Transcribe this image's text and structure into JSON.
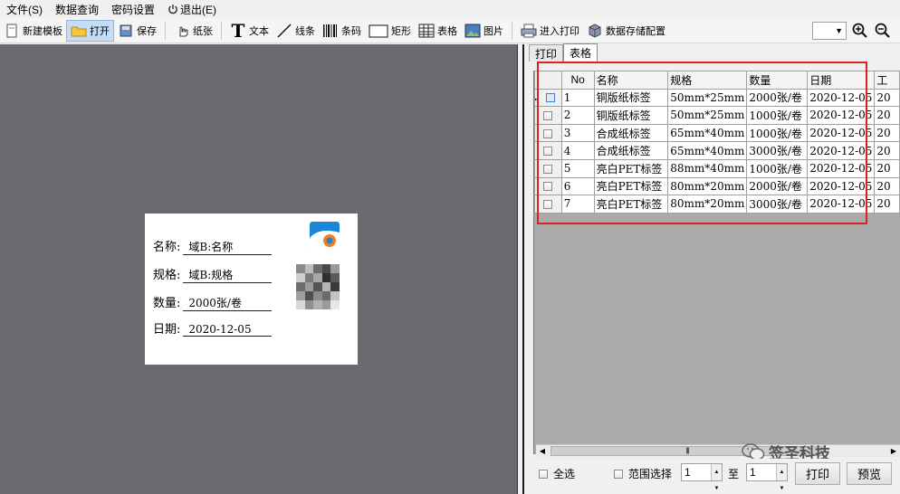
{
  "menu": [
    {
      "label": "文件(S)"
    },
    {
      "label": "数据查询"
    },
    {
      "label": "密码设置"
    },
    {
      "label": "退出(E)",
      "icon": "power-icon"
    }
  ],
  "toolbar": {
    "new_template": "新建模板",
    "open": "打开",
    "save": "保存",
    "paper": "纸张",
    "text": "文本",
    "line": "线条",
    "barcode": "条码",
    "rect": "矩形",
    "table": "表格",
    "image": "图片",
    "enter_print": "进入打印",
    "data_storage": "数据存储配置",
    "zoom_value": ""
  },
  "label": {
    "rows": [
      {
        "key": "名称:",
        "value": "域B:名称"
      },
      {
        "key": "规格:",
        "value": "域B:规格"
      },
      {
        "key": "数量:",
        "value": "2000张/卷"
      },
      {
        "key": "日期:",
        "value": "2020-12-05"
      }
    ]
  },
  "tabs": [
    {
      "label": "打印"
    },
    {
      "label": "表格"
    }
  ],
  "grid": {
    "columns": [
      "No",
      "名称",
      "规格",
      "数量",
      "日期",
      "工"
    ],
    "rows": [
      {
        "no": "1",
        "name": "铜版纸标签",
        "spec": "50mm*25mm",
        "qty": "2000张/卷",
        "date": "2020-12-05",
        "extra": "20"
      },
      {
        "no": "2",
        "name": "铜版纸标签",
        "spec": "50mm*25mm",
        "qty": "1000张/卷",
        "date": "2020-12-05",
        "extra": "20"
      },
      {
        "no": "3",
        "name": "合成纸标签",
        "spec": "65mm*40mm",
        "qty": "1000张/卷",
        "date": "2020-12-05",
        "extra": "20"
      },
      {
        "no": "4",
        "name": "合成纸标签",
        "spec": "65mm*40mm",
        "qty": "3000张/卷",
        "date": "2020-12-05",
        "extra": "20"
      },
      {
        "no": "5",
        "name": "亮白PET标签",
        "spec": "88mm*40mm",
        "qty": "1000张/卷",
        "date": "2020-12-05",
        "extra": "20"
      },
      {
        "no": "6",
        "name": "亮白PET标签",
        "spec": "80mm*20mm",
        "qty": "2000张/卷",
        "date": "2020-12-05",
        "extra": "20"
      },
      {
        "no": "7",
        "name": "亮白PET标签",
        "spec": "80mm*20mm",
        "qty": "3000张/卷",
        "date": "2020-12-05",
        "extra": "20"
      }
    ]
  },
  "bottom": {
    "select_all": "全选",
    "range_select": "范围选择",
    "range_from": "1",
    "to_label": "至",
    "range_to": "1",
    "print_button": "打印",
    "preview_button": "预览"
  },
  "watermark": "签圣科技",
  "colors": {
    "canvas_bg": "#6a696e",
    "highlight_box": "#e02020",
    "grid_bg": "#aaaaaa",
    "logo_blue": "#1a86d6",
    "logo_orange": "#f08020"
  }
}
